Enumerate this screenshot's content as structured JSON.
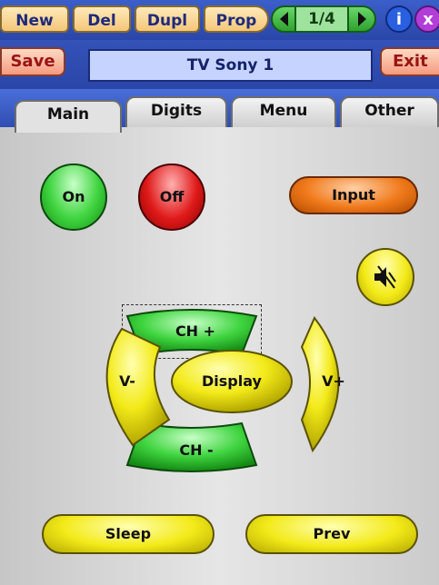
{
  "toolbar": {
    "new_label": "New",
    "del_label": "Del",
    "dupl_label": "Dupl",
    "prop_label": "Prop",
    "page_indicator": "1/4",
    "info_label": "i",
    "close_label": "x"
  },
  "header": {
    "save_label": "Save",
    "title": "TV Sony 1",
    "exit_label": "Exit"
  },
  "tabs": [
    {
      "label": "Main"
    },
    {
      "label": "Digits"
    },
    {
      "label": "Menu"
    },
    {
      "label": "Other"
    }
  ],
  "main": {
    "on_label": "On",
    "off_label": "Off",
    "input_label": "Input",
    "mute_icon": "speaker-mute-icon",
    "ch_up_label": "CH +",
    "ch_down_label": "CH -",
    "vol_down_label": "V-",
    "vol_up_label": "V+",
    "display_label": "Display",
    "sleep_label": "Sleep",
    "prev_label": "Prev"
  },
  "colors": {
    "toolbar_bg": "#2a46a8",
    "green": "#3fd43f",
    "red": "#e01a1a",
    "orange": "#f07a1b",
    "yellow": "#f3ea19"
  }
}
